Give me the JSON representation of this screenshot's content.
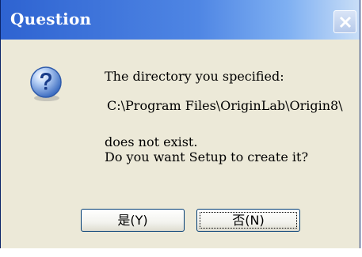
{
  "dialog": {
    "title": "Question",
    "icon": "question-icon",
    "message": {
      "line1": "The directory you specified:",
      "path": "C:\\Program Files\\OriginLab\\Origin8\\",
      "line3": "does not exist.",
      "line4": "Do you want Setup to create it?"
    },
    "buttons": {
      "yes_label": "是(Y)",
      "no_label": "否(N)"
    }
  },
  "colors": {
    "titlebar": "#2e63d1",
    "client_bg": "#ece9d8",
    "button_border": "#003c74"
  }
}
